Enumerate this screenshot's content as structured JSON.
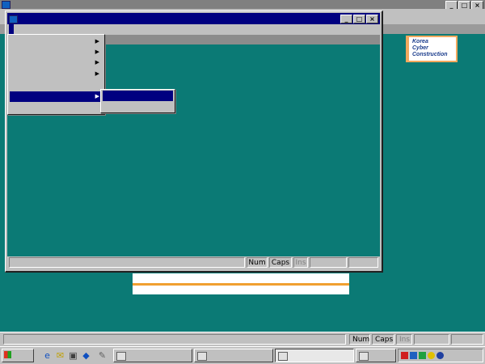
{
  "outer_window": {
    "title": "",
    "controls": {
      "minimize": "_",
      "maximize": "□",
      "close": "×"
    },
    "logo_lines": [
      "Korea",
      "Cyber",
      "Construction"
    ]
  },
  "front_window": {
    "title": "",
    "controls": {
      "minimize": "_",
      "maximize": "□",
      "close": "×"
    },
    "menu": [
      {
        "label": ""
      },
      {
        "label": ""
      }
    ],
    "dropdown": {
      "items": [
        {
          "label": "",
          "submenu": true
        },
        {
          "label": "",
          "submenu": true
        },
        {
          "label": "",
          "submenu": true
        },
        {
          "label": "",
          "submenu": true
        },
        {
          "label": "",
          "submenu": false
        },
        {
          "label": "",
          "submenu": true,
          "highlighted": true
        },
        {
          "label": "",
          "submenu": false
        }
      ],
      "arrow_glyph": "▶"
    },
    "submenu": {
      "items": [
        {
          "label": "",
          "highlighted": true
        },
        {
          "label": "",
          "highlighted": false
        }
      ]
    },
    "status": {
      "message": "",
      "num": "Num",
      "caps": "Caps",
      "ins": "Ins",
      "date": "",
      "time": ""
    }
  },
  "outer_status": {
    "message": "",
    "num": "Num",
    "caps": "Caps",
    "ins": "Ins",
    "date": "",
    "time": ""
  },
  "taskbar": {
    "start_label": "",
    "quick_launch_icons": [
      "ie-icon",
      "outlook-icon",
      "desktop-icon",
      "channel-icon"
    ],
    "tasks": [
      {
        "label": "",
        "active": false
      },
      {
        "label": "",
        "active": false
      },
      {
        "label": "",
        "active": true
      },
      {
        "label": "",
        "active": false
      }
    ],
    "clock": ""
  }
}
